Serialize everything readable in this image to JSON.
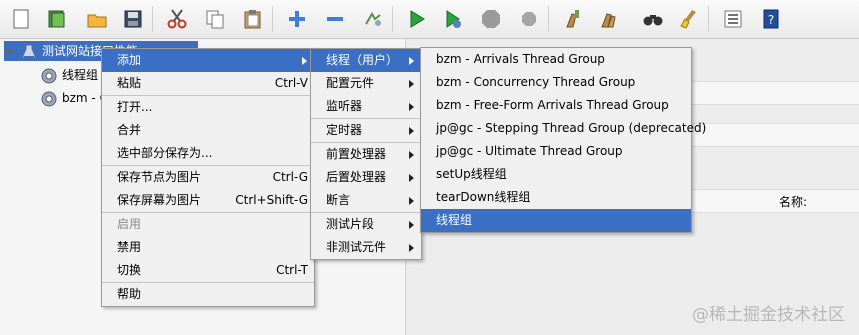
{
  "tree": {
    "root_label": "测试网站接口性能",
    "children": [
      {
        "label": "线程组"
      },
      {
        "label": "bzm - C"
      }
    ]
  },
  "right_panel": {
    "name_label": "名称:"
  },
  "context_menu": {
    "items": [
      {
        "label": "添加",
        "accel": "",
        "submenu": true,
        "selected": true,
        "disabled": false
      },
      {
        "label": "粘贴",
        "accel": "Ctrl-V",
        "submenu": false,
        "selected": false,
        "disabled": false
      },
      {
        "label": "打开...",
        "accel": "",
        "submenu": false,
        "selected": false,
        "disabled": false
      },
      {
        "label": "合并",
        "accel": "",
        "submenu": false,
        "selected": false,
        "disabled": false
      },
      {
        "label": "选中部分保存为...",
        "accel": "",
        "submenu": false,
        "selected": false,
        "disabled": false
      },
      {
        "label": "保存节点为图片",
        "accel": "Ctrl-G",
        "submenu": false,
        "selected": false,
        "disabled": false
      },
      {
        "label": "保存屏幕为图片",
        "accel": "Ctrl+Shift-G",
        "submenu": false,
        "selected": false,
        "disabled": false
      },
      {
        "label": "启用",
        "accel": "",
        "submenu": false,
        "selected": false,
        "disabled": true
      },
      {
        "label": "禁用",
        "accel": "",
        "submenu": false,
        "selected": false,
        "disabled": false
      },
      {
        "label": "切换",
        "accel": "Ctrl-T",
        "submenu": false,
        "selected": false,
        "disabled": false
      },
      {
        "label": "帮助",
        "accel": "",
        "submenu": false,
        "selected": false,
        "disabled": false
      }
    ]
  },
  "add_submenu": {
    "items": [
      {
        "label": "线程（用户）",
        "selected": true
      },
      {
        "label": "配置元件",
        "selected": false
      },
      {
        "label": "监听器",
        "selected": false
      },
      {
        "label": "定时器",
        "selected": false
      },
      {
        "label": "前置处理器",
        "selected": false
      },
      {
        "label": "后置处理器",
        "selected": false
      },
      {
        "label": "断言",
        "selected": false
      },
      {
        "label": "测试片段",
        "selected": false
      },
      {
        "label": "非测试元件",
        "selected": false
      }
    ]
  },
  "thread_submenu": {
    "items": [
      {
        "label": "bzm - Arrivals Thread Group",
        "selected": false
      },
      {
        "label": "bzm - Concurrency Thread Group",
        "selected": false
      },
      {
        "label": "bzm - Free-Form Arrivals Thread Group",
        "selected": false
      },
      {
        "label": "jp@gc - Stepping Thread Group (deprecated)",
        "selected": false
      },
      {
        "label": "jp@gc - Ultimate Thread Group",
        "selected": false
      },
      {
        "label": "setUp线程组",
        "selected": false
      },
      {
        "label": "tearDown线程组",
        "selected": false
      },
      {
        "label": "线程组",
        "selected": true
      }
    ]
  },
  "toolbar": {
    "buttons": [
      "new-icon",
      "templates-icon",
      "open-icon",
      "save-icon",
      "cut-icon",
      "copy-icon",
      "paste-icon",
      "expand-icon",
      "collapse-icon",
      "toggle-icon",
      "start-icon",
      "start-no-pause-icon",
      "stop-icon",
      "shutdown-icon",
      "clear-icon",
      "clear-all-icon",
      "search-icon",
      "reset-search-icon",
      "function-helper-icon",
      "help-icon"
    ]
  },
  "watermark": "@稀土掘金技术社区"
}
